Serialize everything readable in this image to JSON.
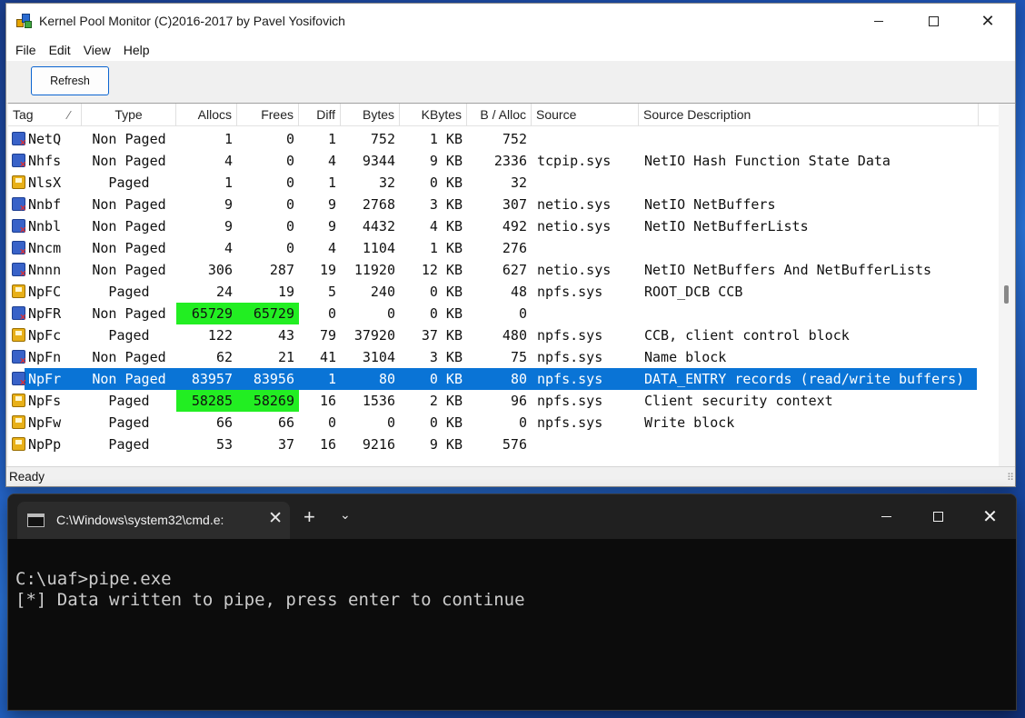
{
  "monitor": {
    "title": "Kernel Pool Monitor (C)2016-2017 by Pavel Yosifovich",
    "window_controls": {
      "minimize": "—",
      "maximize": "□",
      "close": "✕"
    },
    "menu": [
      "File",
      "Edit",
      "View",
      "Help"
    ],
    "toolbar": {
      "refresh_label": "Refresh"
    },
    "columns": {
      "tag": "Tag",
      "type": "Type",
      "allocs": "Allocs",
      "frees": "Frees",
      "diff": "Diff",
      "bytes": "Bytes",
      "kbytes": "KBytes",
      "b_alloc": "B / Alloc",
      "source": "Source",
      "source_desc": "Source Description"
    },
    "rows": [
      {
        "tag": "NetQ",
        "type": "Non Paged",
        "allocs": "1",
        "frees": "0",
        "diff": "1",
        "bytes": "752",
        "kbytes": "1 KB",
        "b_alloc": "752",
        "source": "",
        "desc": ""
      },
      {
        "tag": "Nhfs",
        "type": "Non Paged",
        "allocs": "4",
        "frees": "0",
        "diff": "4",
        "bytes": "9344",
        "kbytes": "9 KB",
        "b_alloc": "2336",
        "source": "tcpip.sys",
        "desc": "NetIO Hash Function State Data"
      },
      {
        "tag": "NlsX",
        "type": "Paged",
        "allocs": "1",
        "frees": "0",
        "diff": "1",
        "bytes": "32",
        "kbytes": "0 KB",
        "b_alloc": "32",
        "source": "",
        "desc": ""
      },
      {
        "tag": "Nnbf",
        "type": "Non Paged",
        "allocs": "9",
        "frees": "0",
        "diff": "9",
        "bytes": "2768",
        "kbytes": "3 KB",
        "b_alloc": "307",
        "source": "netio.sys",
        "desc": "NetIO NetBuffers"
      },
      {
        "tag": "Nnbl",
        "type": "Non Paged",
        "allocs": "9",
        "frees": "0",
        "diff": "9",
        "bytes": "4432",
        "kbytes": "4 KB",
        "b_alloc": "492",
        "source": "netio.sys",
        "desc": "NetIO NetBufferLists"
      },
      {
        "tag": "Nncm",
        "type": "Non Paged",
        "allocs": "4",
        "frees": "0",
        "diff": "4",
        "bytes": "1104",
        "kbytes": "1 KB",
        "b_alloc": "276",
        "source": "",
        "desc": ""
      },
      {
        "tag": "Nnnn",
        "type": "Non Paged",
        "allocs": "306",
        "frees": "287",
        "diff": "19",
        "bytes": "11920",
        "kbytes": "12 KB",
        "b_alloc": "627",
        "source": "netio.sys",
        "desc": "NetIO NetBuffers And NetBufferLists"
      },
      {
        "tag": "NpFC",
        "type": "Paged",
        "allocs": "24",
        "frees": "19",
        "diff": "5",
        "bytes": "240",
        "kbytes": "0 KB",
        "b_alloc": "48",
        "source": "npfs.sys",
        "desc": "ROOT_DCB CCB"
      },
      {
        "tag": "NpFR",
        "type": "Non Paged",
        "allocs": "65729",
        "frees": "65729",
        "diff": "0",
        "bytes": "0",
        "kbytes": "0 KB",
        "b_alloc": "0",
        "source": "",
        "desc": ""
      },
      {
        "tag": "NpFc",
        "type": "Paged",
        "allocs": "122",
        "frees": "43",
        "diff": "79",
        "bytes": "37920",
        "kbytes": "37 KB",
        "b_alloc": "480",
        "source": "npfs.sys",
        "desc": "CCB, client control block"
      },
      {
        "tag": "NpFn",
        "type": "Non Paged",
        "allocs": "62",
        "frees": "21",
        "diff": "41",
        "bytes": "3104",
        "kbytes": "3 KB",
        "b_alloc": "75",
        "source": "npfs.sys",
        "desc": "Name block"
      },
      {
        "tag": "NpFr",
        "type": "Non Paged",
        "allocs": "83957",
        "frees": "83956",
        "diff": "1",
        "bytes": "80",
        "kbytes": "0 KB",
        "b_alloc": "80",
        "source": "npfs.sys",
        "desc": "DATA_ENTRY records (read/write buffers)"
      },
      {
        "tag": "NpFs",
        "type": "Paged",
        "allocs": "58285",
        "frees": "58269",
        "diff": "16",
        "bytes": "1536",
        "kbytes": "2 KB",
        "b_alloc": "96",
        "source": "npfs.sys",
        "desc": "Client security context"
      },
      {
        "tag": "NpFw",
        "type": "Paged",
        "allocs": "66",
        "frees": "66",
        "diff": "0",
        "bytes": "0",
        "kbytes": "0 KB",
        "b_alloc": "0",
        "source": "npfs.sys",
        "desc": "Write block"
      },
      {
        "tag": "NpPp",
        "type": "Paged",
        "allocs": "53",
        "frees": "37",
        "diff": "16",
        "bytes": "9216",
        "kbytes": "9 KB",
        "b_alloc": "576",
        "source": "",
        "desc": ""
      }
    ],
    "selected_row": 11,
    "highlighted_rows": [
      8,
      12
    ],
    "colors": {
      "highlight": "#22ee22",
      "selection": "#0a74d6"
    },
    "status": "Ready"
  },
  "terminal": {
    "tab_title": "C:\\Windows\\system32\\cmd.e:",
    "new_tab": "+",
    "dropdown": "⌄",
    "tab_close": "✕",
    "lines": [
      "C:\\uaf>pipe.exe",
      "[*] Data written to pipe, press enter to continue"
    ]
  }
}
